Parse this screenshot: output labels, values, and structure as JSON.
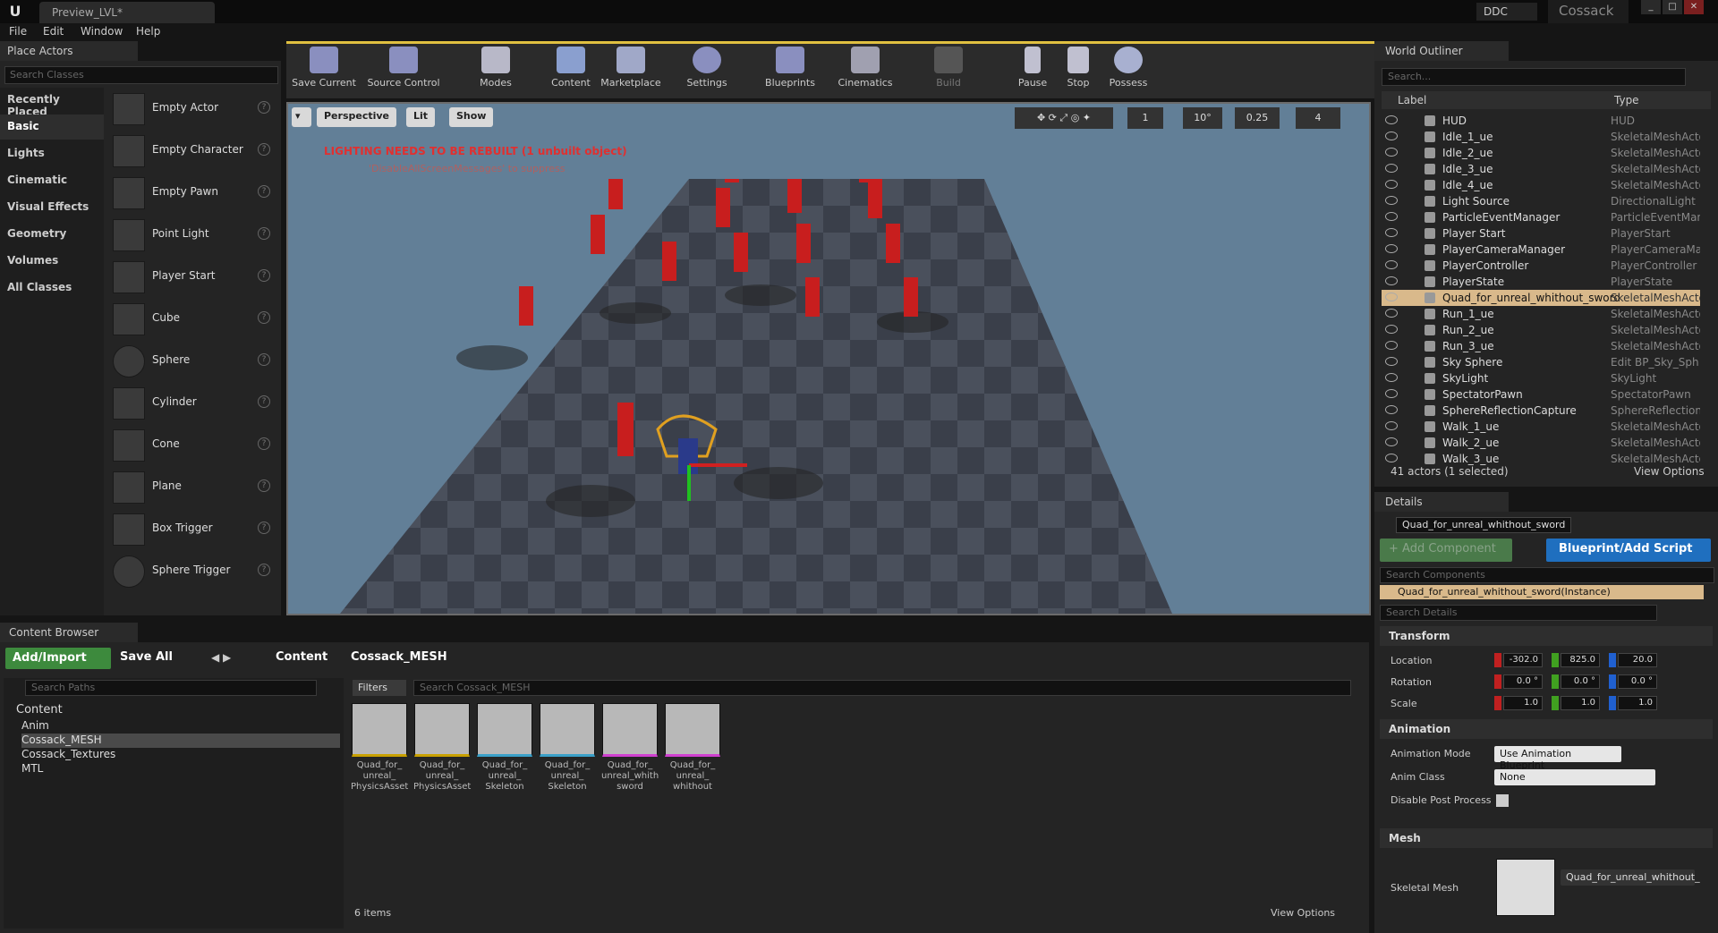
{
  "title_bar": {
    "tab": "Preview_LVL*",
    "ddc": "DDC",
    "project": "Cossack"
  },
  "menu": [
    "File",
    "Edit",
    "Window",
    "Help"
  ],
  "place_actors": {
    "tab": "Place Actors",
    "search_placeholder": "Search Classes",
    "categories": [
      "Recently Placed",
      "Basic",
      "Lights",
      "Cinematic",
      "Visual Effects",
      "Geometry",
      "Volumes",
      "All Classes"
    ],
    "actors": [
      "Empty Actor",
      "Empty Character",
      "Empty Pawn",
      "Point Light",
      "Player Start",
      "Cube",
      "Sphere",
      "Cylinder",
      "Cone",
      "Plane",
      "Box Trigger",
      "Sphere Trigger"
    ]
  },
  "toolbar": [
    "Save Current",
    "Source Control",
    "Modes",
    "Content",
    "Marketplace",
    "Settings",
    "Blueprints",
    "Cinematics",
    "Build",
    "Pause",
    "Stop",
    "Possess"
  ],
  "viewport": {
    "perspective": "Perspective",
    "lit": "Lit",
    "show": "Show",
    "warning": "LIGHTING NEEDS TO BE REBUILT (1 unbuilt object)",
    "suppress": "'DisableAllScreenMessages' to suppress",
    "snap_count": "1",
    "rotation_snap": "10°",
    "scale_snap": "0.25",
    "camera_speed": "4"
  },
  "outliner": {
    "tab": "World Outliner",
    "search_placeholder": "Search...",
    "col_label": "Label",
    "col_type": "Type",
    "rows": [
      {
        "label": "HUD",
        "type": "HUD"
      },
      {
        "label": "Idle_1_ue",
        "type": "SkeletalMeshActo"
      },
      {
        "label": "Idle_2_ue",
        "type": "SkeletalMeshActo"
      },
      {
        "label": "Idle_3_ue",
        "type": "SkeletalMeshActo"
      },
      {
        "label": "Idle_4_ue",
        "type": "SkeletalMeshActo"
      },
      {
        "label": "Light Source",
        "type": "DirectionalLight"
      },
      {
        "label": "ParticleEventManager",
        "type": "ParticleEventMan"
      },
      {
        "label": "Player Start",
        "type": "PlayerStart"
      },
      {
        "label": "PlayerCameraManager",
        "type": "PlayerCameraMar"
      },
      {
        "label": "PlayerController",
        "type": "PlayerController"
      },
      {
        "label": "PlayerState",
        "type": "PlayerState"
      },
      {
        "label": "Quad_for_unreal_whithout_sword",
        "type": "SkeletalMeshActo"
      },
      {
        "label": "Run_1_ue",
        "type": "SkeletalMeshActo"
      },
      {
        "label": "Run_2_ue",
        "type": "SkeletalMeshActo"
      },
      {
        "label": "Run_3_ue",
        "type": "SkeletalMeshActo"
      },
      {
        "label": "Sky Sphere",
        "type": "Edit BP_Sky_Sph"
      },
      {
        "label": "SkyLight",
        "type": "SkyLight"
      },
      {
        "label": "SpectatorPawn",
        "type": "SpectatorPawn"
      },
      {
        "label": "SphereReflectionCapture",
        "type": "SphereReflectionC"
      },
      {
        "label": "Walk_1_ue",
        "type": "SkeletalMeshActo"
      },
      {
        "label": "Walk_2_ue",
        "type": "SkeletalMeshActo"
      },
      {
        "label": "Walk_3_ue",
        "type": "SkeletalMeshActo"
      }
    ],
    "footer": "41 actors (1 selected)",
    "view_options": "View Options"
  },
  "details": {
    "tab": "Details",
    "actor_name": "Quad_for_unreal_whithout_sword",
    "add_component": "+ Add Component",
    "blueprint": "Blueprint/Add Script",
    "search_components": "Search Components",
    "instance": "Quad_for_unreal_whithout_sword(Instance)",
    "search_details": "Search Details",
    "transform": "Transform",
    "location_label": "Location",
    "location": [
      "-302.0",
      "825.0",
      "20.0"
    ],
    "rotation_label": "Rotation",
    "rotation": [
      "0.0 °",
      "0.0 °",
      "0.0 °"
    ],
    "scale_label": "Scale",
    "scale": [
      "1.0",
      "1.0",
      "1.0"
    ],
    "animation": "Animation",
    "anim_mode_label": "Animation Mode",
    "anim_mode": "Use Animation Blueprint",
    "anim_class_label": "Anim Class",
    "anim_class": "None",
    "disable_pp_label": "Disable Post Process",
    "mesh": "Mesh",
    "skeletal_mesh_label": "Skeletal Mesh",
    "skeletal_mesh": "Quad_for_unreal_whithout_"
  },
  "content_browser": {
    "tab": "Content Browser",
    "add_import": "Add/Import",
    "save_all": "Save All",
    "crumb_root": "Content",
    "crumb_folder": "Cossack_MESH",
    "search_paths": "Search Paths",
    "filters": "Filters",
    "search_assets": "Search Cossack_MESH",
    "tree_root": "Content",
    "folders": [
      "Anim",
      "Cossack_MESH",
      "Cossack_Textures",
      "MTL"
    ],
    "assets": [
      {
        "name": "Quad_for_ unreal_ PhysicsAsset",
        "accent": "#c8a000"
      },
      {
        "name": "Quad_for_ unreal_ PhysicsAsset",
        "accent": "#c8a000"
      },
      {
        "name": "Quad_for_ unreal_ Skeleton",
        "accent": "#3aa0c8"
      },
      {
        "name": "Quad_for_ unreal_ Skeleton",
        "accent": "#3aa0c8"
      },
      {
        "name": "Quad_for_ unreal_whith sword",
        "accent": "#d040d0"
      },
      {
        "name": "Quad_for_ unreal_ whithout",
        "accent": "#d040d0"
      }
    ],
    "items": "6 items",
    "view_options": "View Options"
  },
  "colors": {
    "accent_yellow": "#e0c040",
    "selection": "#d9b98b",
    "blue": "#1f6fbf",
    "green": "#3d8a3d"
  }
}
